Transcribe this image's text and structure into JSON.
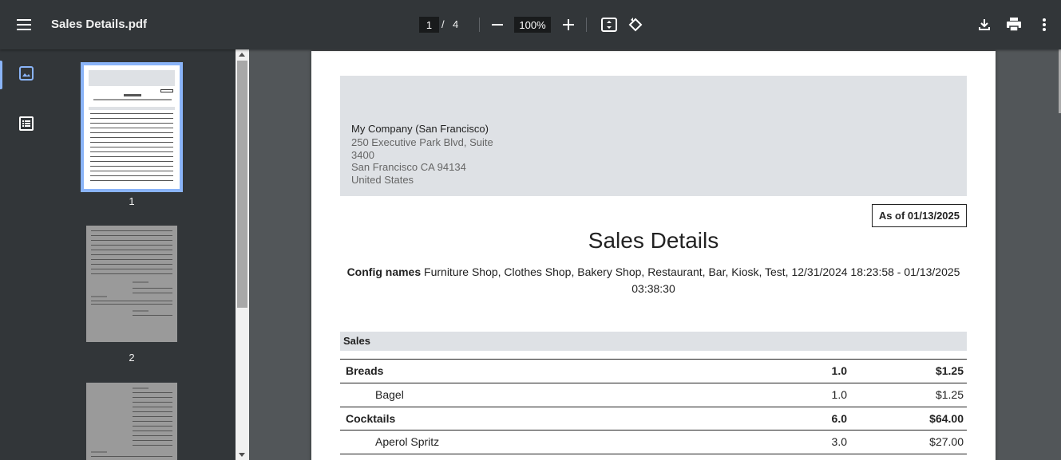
{
  "toolbar": {
    "title": "Sales Details.pdf",
    "current_page": "1",
    "page_separator": "/",
    "total_pages": "4",
    "zoom": "100%"
  },
  "sidebar": {
    "thumbnails": [
      {
        "label": "1"
      },
      {
        "label": "2"
      },
      {
        "label": ""
      }
    ]
  },
  "document": {
    "company_name": "My Company (San Francisco)",
    "address": [
      "250 Executive Park Blvd, Suite",
      "3400",
      "San Francisco CA 94134",
      "United States"
    ],
    "as_of": "As of 01/13/2025",
    "title": "Sales Details",
    "config_label": "Config names",
    "config_value_line1": "Furniture Shop, Clothes Shop, Bakery Shop, Restaurant, Bar, Kiosk, Test, 12/31/2024 18:23:58 - 01/13/2025",
    "config_value_line2": "03:38:30",
    "section": "Sales",
    "rows": [
      {
        "name": "Breads",
        "qty": "1.0",
        "amount": "$1.25",
        "type": "category"
      },
      {
        "name": "Bagel",
        "qty": "1.0",
        "amount": "$1.25",
        "type": "item"
      },
      {
        "name": "Cocktails",
        "qty": "6.0",
        "amount": "$64.00",
        "type": "category"
      },
      {
        "name": "Aperol Spritz",
        "qty": "3.0",
        "amount": "$27.00",
        "type": "item"
      }
    ]
  },
  "colors": {
    "toolbar_bg": "#323639",
    "viewer_bg": "#525659",
    "accent": "#8ab4f8",
    "header_band": "#dee1e5"
  }
}
